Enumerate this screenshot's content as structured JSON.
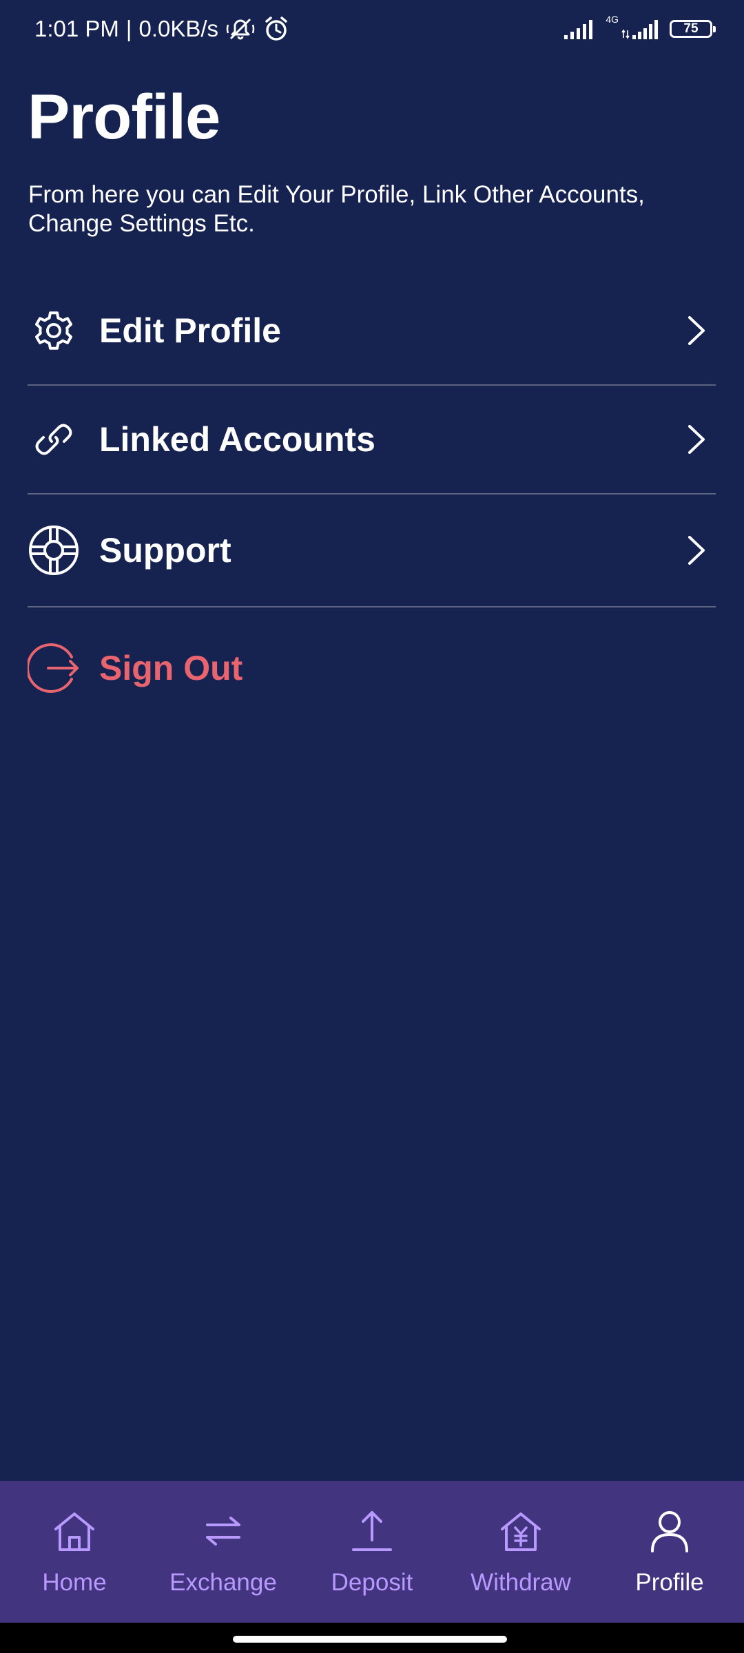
{
  "status_bar": {
    "time": "1:01 PM",
    "separator": "|",
    "speed": "0.0KB/s",
    "network_tag": "4G",
    "battery": "75",
    "icons": [
      "mute-icon",
      "alarm-icon",
      "signal-icon",
      "signal-4g-icon",
      "battery-icon"
    ]
  },
  "header": {
    "title": "Profile",
    "subtitle": "From here you can Edit Your Profile, Link Other Accounts, Change Settings Etc."
  },
  "menu": {
    "items": [
      {
        "label": "Edit Profile",
        "icon": "gear-icon"
      },
      {
        "label": "Linked Accounts",
        "icon": "link-icon"
      },
      {
        "label": "Support",
        "icon": "lifebuoy-icon"
      }
    ],
    "sign_out": {
      "label": "Sign Out",
      "icon": "logout-icon",
      "color": "#e8656f"
    }
  },
  "bottom_nav": {
    "items": [
      {
        "label": "Home",
        "icon": "home-icon"
      },
      {
        "label": "Exchange",
        "icon": "exchange-icon"
      },
      {
        "label": "Deposit",
        "icon": "upload-icon"
      },
      {
        "label": "Withdraw",
        "icon": "withdraw-icon"
      },
      {
        "label": "Profile",
        "icon": "user-icon"
      }
    ],
    "active": "Profile"
  },
  "colors": {
    "background": "#16224f",
    "nav_background": "#433480",
    "nav_inactive": "#b89aff",
    "nav_active": "#ffffff",
    "danger": "#e8656f",
    "divider": "#5c6480"
  }
}
